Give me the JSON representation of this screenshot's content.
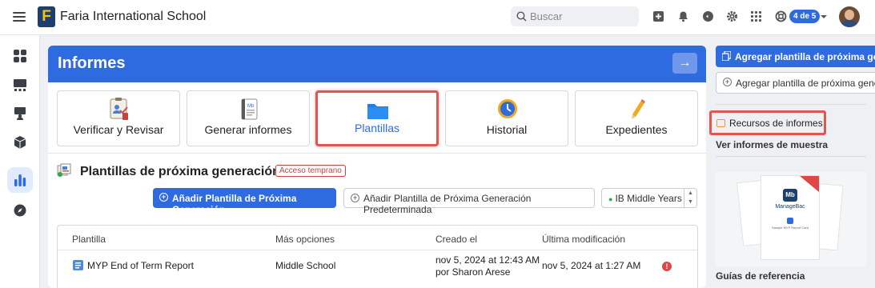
{
  "header": {
    "logo_letter": "F",
    "school": "Faria International School",
    "search_placeholder": "Buscar",
    "page_badge": "4 de 5"
  },
  "panel": {
    "title": "Informes",
    "tiles": [
      {
        "label": "Verificar y Revisar",
        "icon": "review-icon"
      },
      {
        "label": "Generar informes",
        "icon": "report-book-icon"
      },
      {
        "label": "Plantillas",
        "icon": "folder-icon",
        "selected": true
      },
      {
        "label": "Historial",
        "icon": "clock-icon"
      },
      {
        "label": "Expedientes",
        "icon": "pencil-icon"
      }
    ],
    "section_title": "Plantillas de próxima generación",
    "early_badge": "Acceso temprano",
    "add_button": "Añadir Plantilla de Próxima Generación",
    "add_default_button": "Añadir Plantilla de Próxima Generación Predeterminada",
    "program_select": "IB Middle Years",
    "table": {
      "columns": [
        "Plantilla",
        "Más opciones",
        "Creado el",
        "Última modificación"
      ],
      "rows": [
        {
          "name": "MYP End of Term Report",
          "options": "Middle School",
          "created": "nov 5, 2024 at 12:43 AM",
          "created_by": "por Sharon Arese",
          "modified": "nov 5, 2024 at 1:27 AM",
          "warning": "!"
        }
      ]
    }
  },
  "right": {
    "primary_button": "Agregar plantilla de próxima generación",
    "secondary_button": "Agregar plantilla de próxima generación",
    "resources_label": "Recursos de informes",
    "sample_label": "Ver informes de muestra",
    "thumb_brand": "ManageBac",
    "thumb_caption": "Sample MYP Report Card",
    "guides_label": "Guías de referencia"
  },
  "colors": {
    "accent": "#2f6be0",
    "highlight": "#e1574f",
    "warning": "#e04646"
  }
}
